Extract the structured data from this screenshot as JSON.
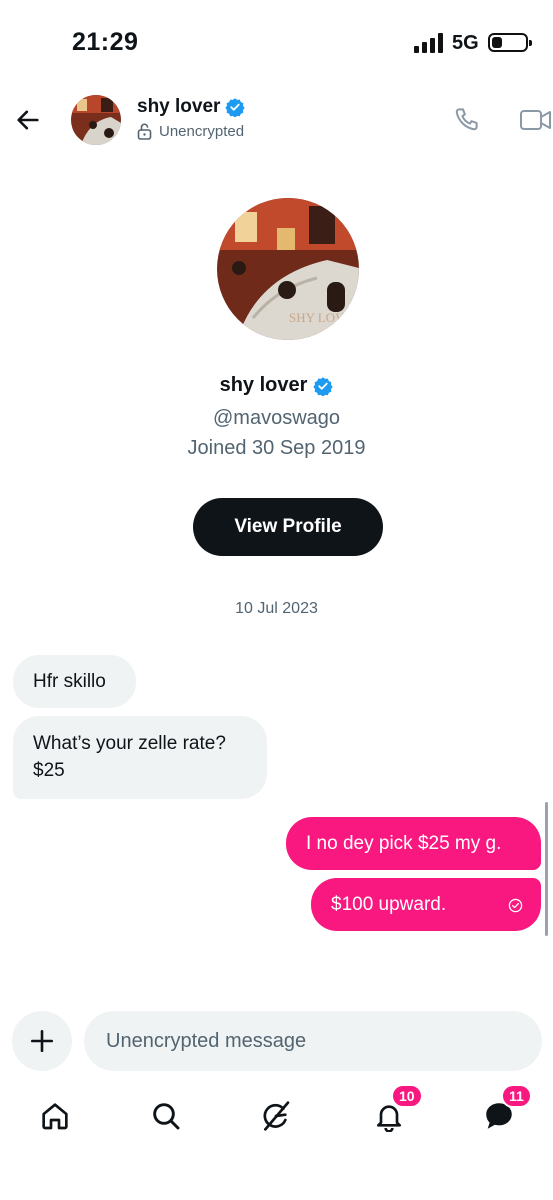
{
  "status_bar": {
    "time": "21:29",
    "network": "5G",
    "battery_level": 0.3
  },
  "header": {
    "name": "shy lover",
    "encryption_status": "Unencrypted",
    "icons": {
      "back": "arrow-left-icon",
      "lock": "lock-open-icon",
      "verified": "verified-badge-icon",
      "call": "phone-icon",
      "video": "video-camera-icon"
    }
  },
  "profile": {
    "name": "shy lover",
    "handle": "@mavoswago",
    "joined": "Joined 30 Sep 2019",
    "view_profile_label": "View Profile",
    "avatar_caption": "SHY LOVE"
  },
  "conversation": {
    "date": "10 Jul 2023",
    "messages": [
      {
        "direction": "incoming",
        "text": "Hfr skillo"
      },
      {
        "direction": "incoming",
        "lines": [
          "What’s your zelle rate?",
          "$25"
        ]
      },
      {
        "direction": "outgoing",
        "text": "I no dey pick $25 my g."
      },
      {
        "direction": "outgoing",
        "text": "$100 upward.",
        "status_icon": "read-check-icon"
      }
    ]
  },
  "composer": {
    "placeholder": "Unencrypted message",
    "add_icon": "plus-icon"
  },
  "bottom_nav": {
    "items": [
      {
        "name": "home",
        "icon": "home-icon"
      },
      {
        "name": "search",
        "icon": "search-icon"
      },
      {
        "name": "grok",
        "icon": "grok-icon"
      },
      {
        "name": "notifications",
        "icon": "bell-icon",
        "badge": "10"
      },
      {
        "name": "messages",
        "icon": "messages-icon",
        "badge": "11"
      }
    ]
  },
  "colors": {
    "accent_pink": "#f91880",
    "verified_blue": "#1d9bf0",
    "bubble_gray": "#eff3f4",
    "text_secondary": "#536471"
  }
}
